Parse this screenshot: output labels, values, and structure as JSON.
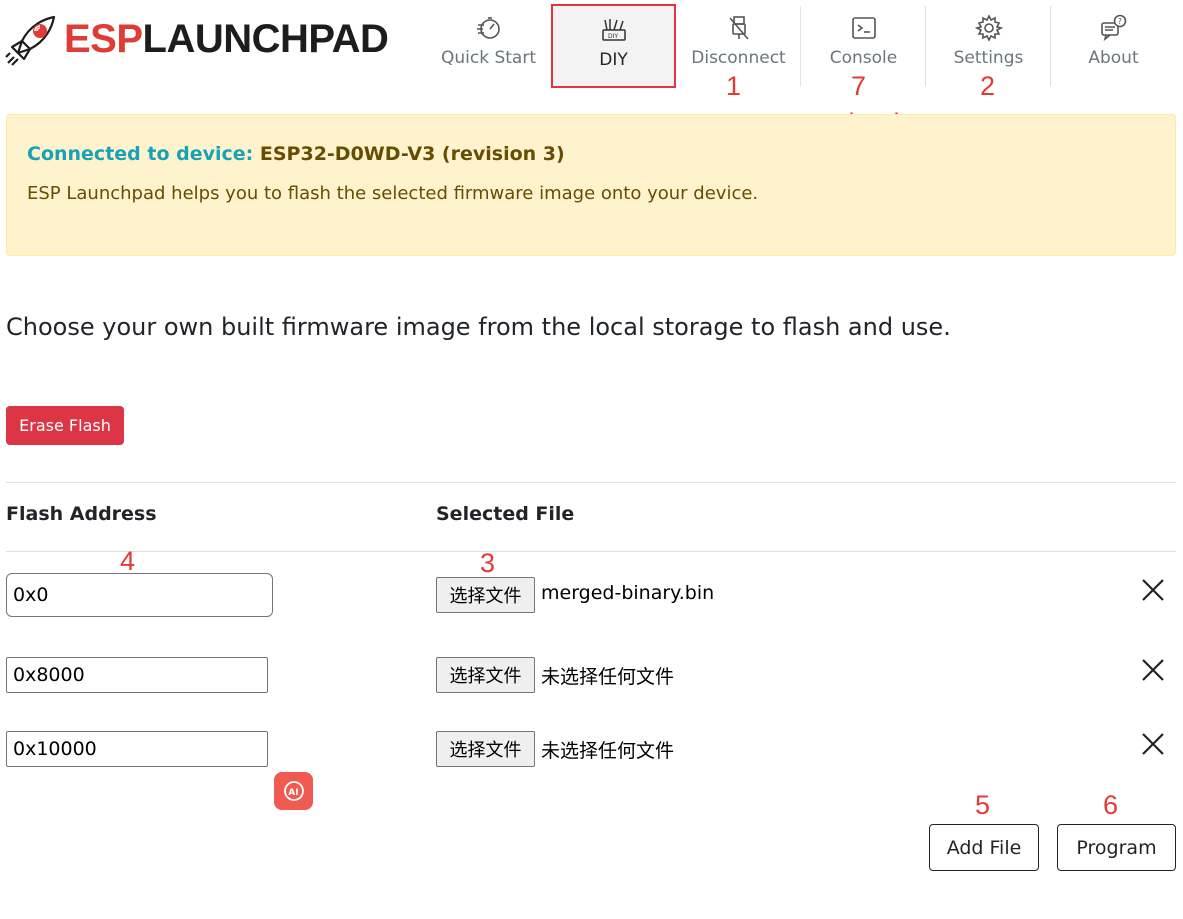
{
  "header": {
    "logo_esp": "ESP",
    "logo_launchpad": "LAUNCHPAD",
    "nav": [
      {
        "label": "Quick Start",
        "icon": "speedometer-icon"
      },
      {
        "label": "DIY",
        "icon": "diy-tools-icon"
      },
      {
        "label": "Disconnect",
        "icon": "usb-disconnect-icon"
      },
      {
        "label": "Console",
        "icon": "terminal-icon"
      },
      {
        "label": "Settings",
        "icon": "gear-icon"
      },
      {
        "label": "About",
        "icon": "chat-question-icon"
      }
    ]
  },
  "annotations": {
    "n1": "1",
    "n7": "7",
    "n2": "2",
    "monitor_log": "monitor log",
    "n4": "4",
    "n3": "3",
    "n5": "5",
    "n6": "6"
  },
  "alert": {
    "connected_label": "Connected to device:",
    "device": "ESP32-D0WD-V3 (revision 3)",
    "message": "ESP Launchpad helps you to flash the selected firmware image onto your device."
  },
  "lead": "Choose your own built firmware image from the local storage to flash and use.",
  "erase_button": "Erase Flash",
  "table": {
    "col_address": "Flash Address",
    "col_file": "Selected File",
    "rows": [
      {
        "address": "0x0",
        "file_button": "选择文件",
        "file_name": "merged-binary.bin"
      },
      {
        "address": "0x8000",
        "file_button": "选择文件",
        "file_name": "未选择任何文件"
      },
      {
        "address": "0x10000",
        "file_button": "选择文件",
        "file_name": "未选择任何文件"
      }
    ]
  },
  "ai_badge": "AI",
  "add_file_button": "Add File",
  "program_button": "Program",
  "colors": {
    "brand_red": "#e03c37",
    "active_border": "#e2353d",
    "alert_bg": "#fff3cd",
    "alert_text": "#664d03",
    "connected_label": "#17a2b8",
    "danger": "#dc3545",
    "annotation": "#e53935"
  }
}
